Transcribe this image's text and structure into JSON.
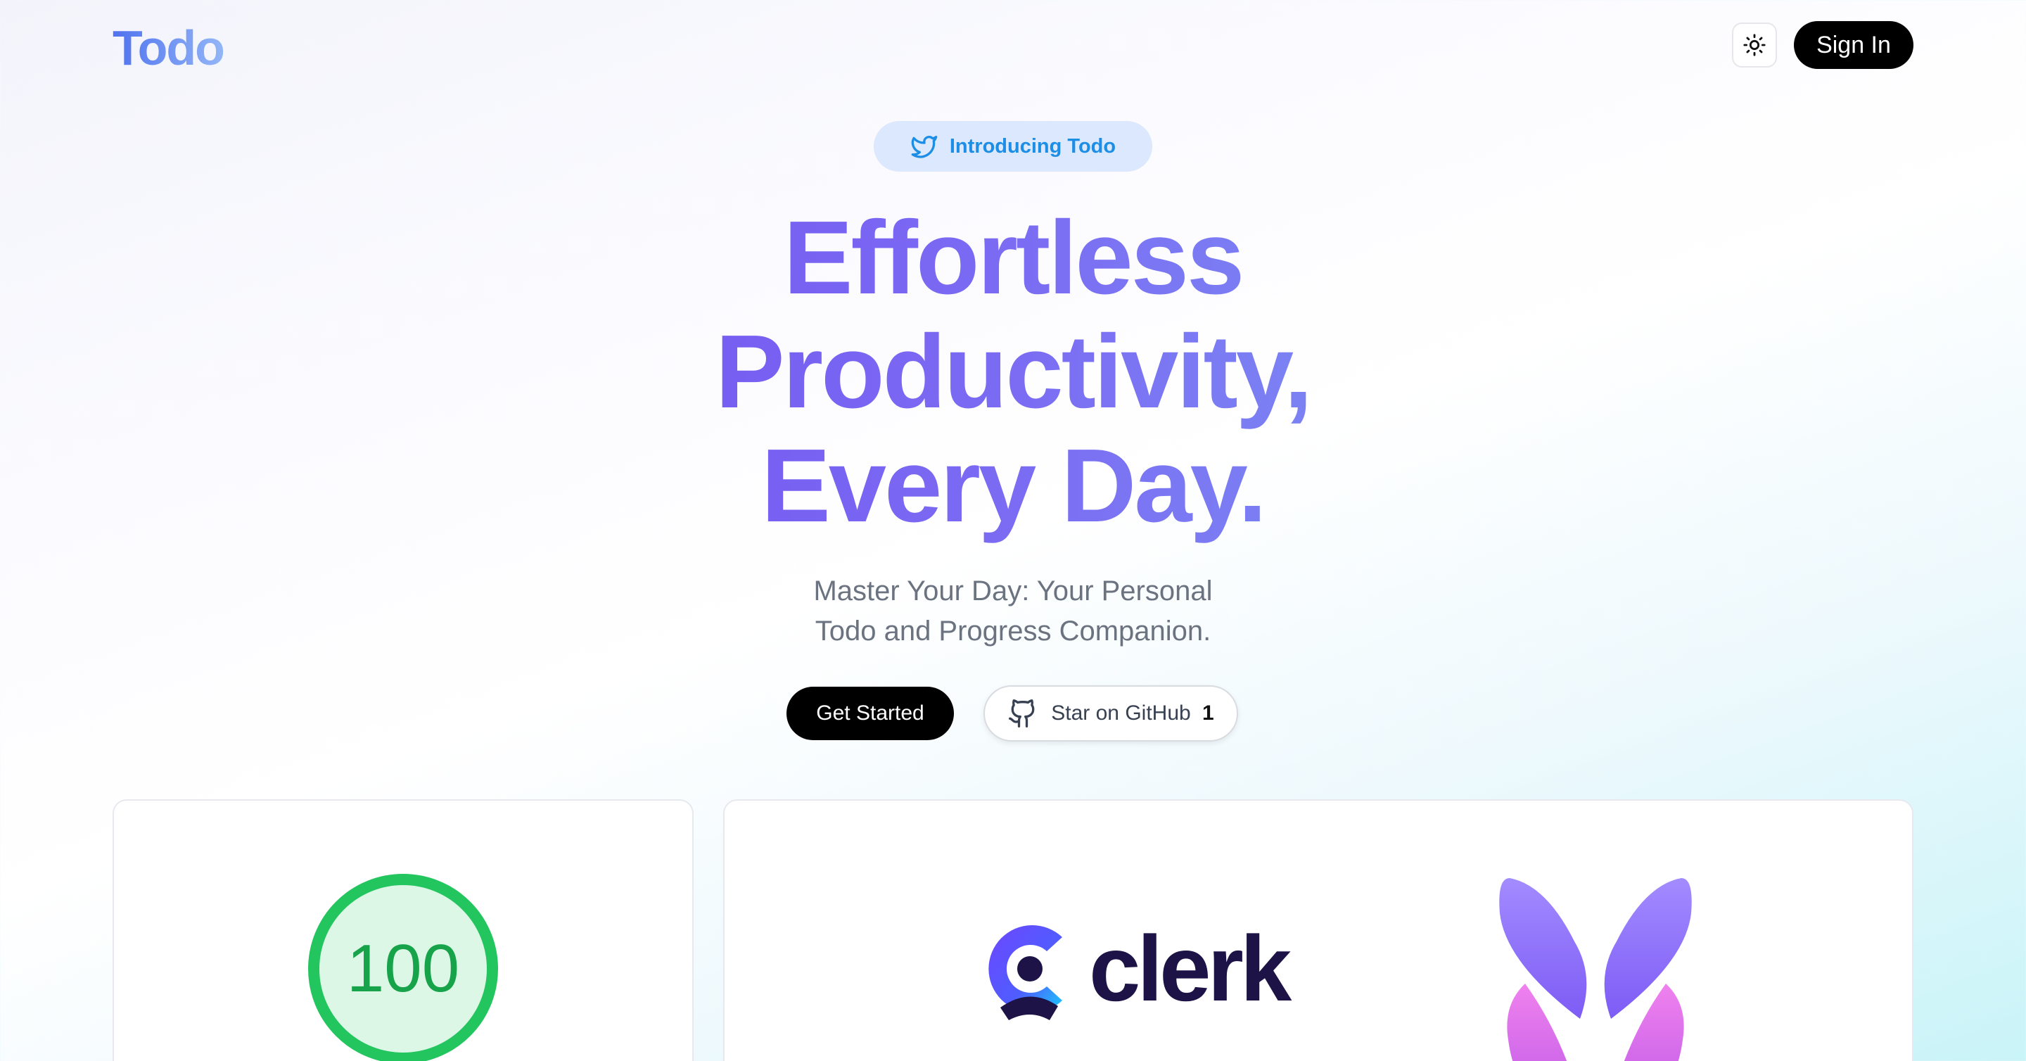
{
  "header": {
    "logo": "Todo",
    "theme_toggle_icon": "sun-icon",
    "sign_in_label": "Sign In"
  },
  "hero": {
    "badge_icon": "twitter-icon",
    "badge_text": "Introducing Todo",
    "title_lines": [
      "Effortless",
      "Productivity,",
      "Every Day."
    ],
    "subtitle_lines": [
      "Master Your Day: Your Personal",
      "Todo and Progress Companion."
    ],
    "primary_cta": "Get Started",
    "github_cta": "Star on GitHub",
    "github_stars": "1"
  },
  "cards": {
    "score": "100",
    "stack_logo_text": "clerk"
  },
  "colors": {
    "accent_purple": "#6c3cf0",
    "accent_blue": "#7cb6f4",
    "badge_bg": "#dbe8fd",
    "score_green": "#22c55e",
    "clerk_navy": "#1d1346"
  }
}
